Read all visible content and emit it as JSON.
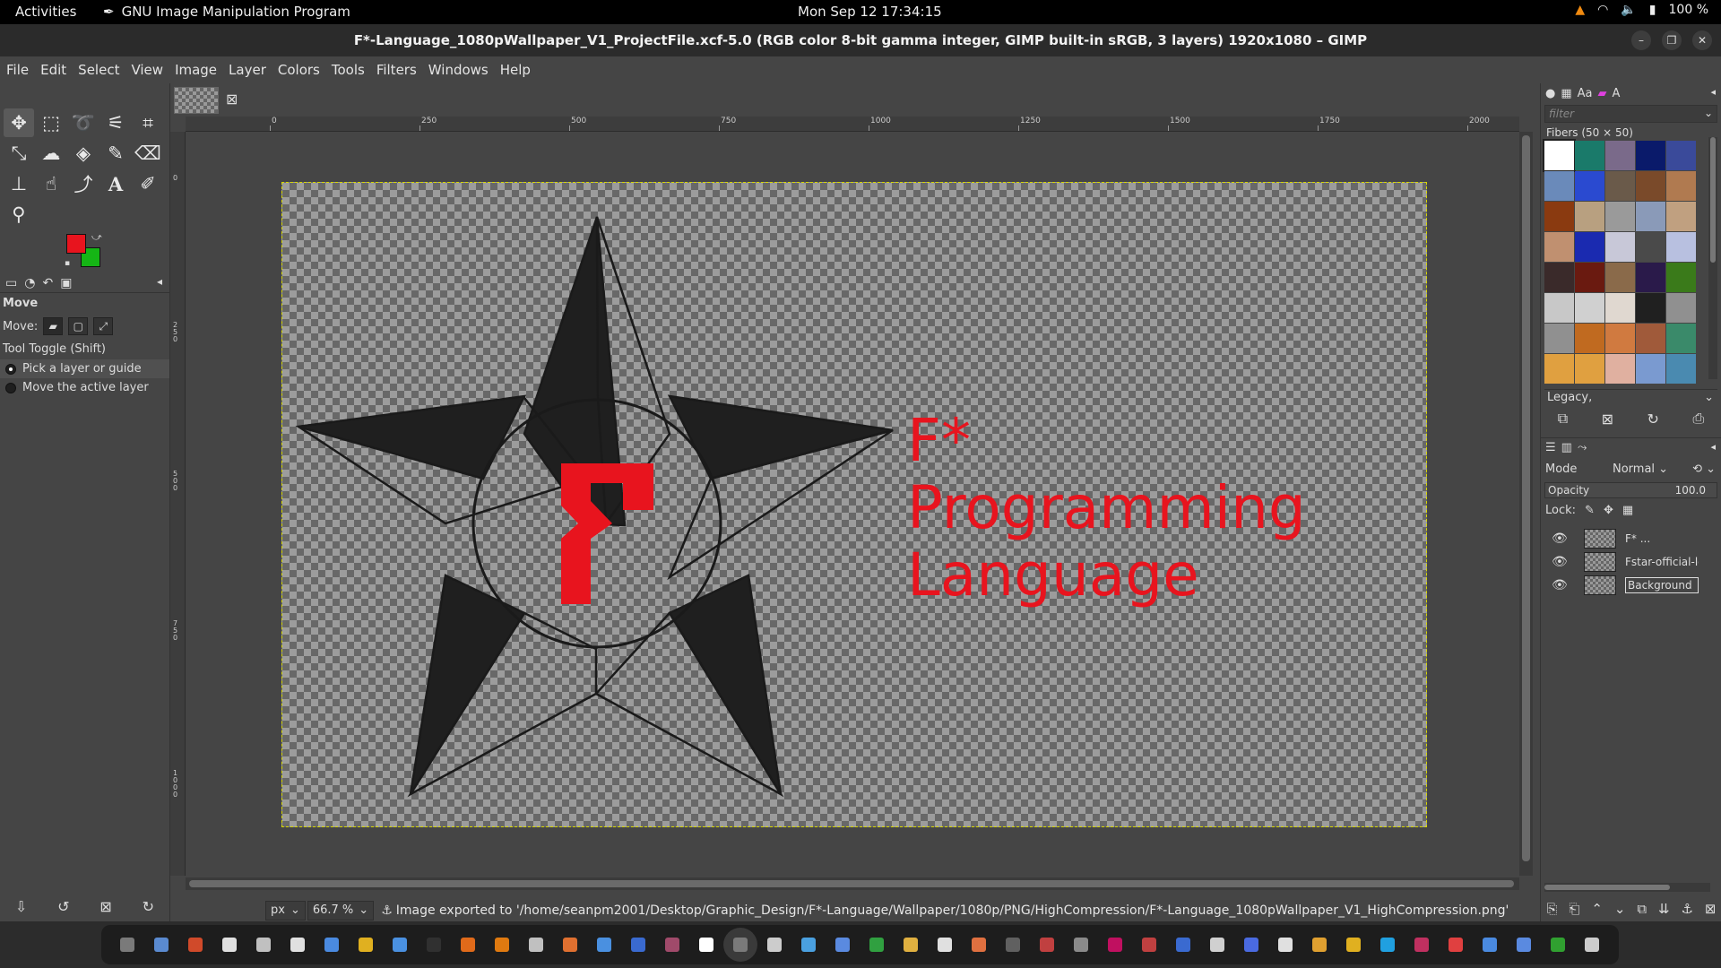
{
  "topbar": {
    "activities": "Activities",
    "app_name": "GNU Image Manipulation Program",
    "clock": "Mon Sep 12  17:34:15",
    "battery": "100 %"
  },
  "window": {
    "title": "F*-Language_1080pWallpaper_V1_ProjectFile.xcf-5.0 (RGB color 8-bit gamma integer, GIMP built-in sRGB, 3 layers) 1920x1080 – GIMP"
  },
  "menu": [
    "File",
    "Edit",
    "Select",
    "View",
    "Image",
    "Layer",
    "Colors",
    "Tools",
    "Filters",
    "Windows",
    "Help"
  ],
  "toolbox": {
    "tools": [
      "move-tool-icon",
      "rect-select-icon",
      "lasso-icon",
      "fuzzy-select-icon",
      "crop-icon",
      "unified-transform-icon",
      "warp-icon",
      "bucket-fill-icon",
      "paintbrush-icon",
      "eraser-icon",
      "clone-icon",
      "smudge-icon",
      "paths-icon",
      "text-tool-icon",
      "color-picker-icon",
      "zoom-tool-icon"
    ],
    "fg_color": "#e8141e",
    "bg_color": "#15b515"
  },
  "tool_options": {
    "title": "Move",
    "move_label": "Move:",
    "toggle_label": "Tool Toggle  (Shift)",
    "option1": "Pick a layer or guide",
    "option2": "Move the active layer"
  },
  "ruler": {
    "h_labels": [
      "0",
      "250",
      "500",
      "750",
      "1000",
      "1250",
      "1500",
      "1750",
      "2000"
    ],
    "v_labels": [
      "0",
      "250",
      "500",
      "750",
      "1000"
    ]
  },
  "canvas": {
    "line1": "F*",
    "line2": "Programming",
    "line3": "Language",
    "text_color": "#e8141e",
    "star_color": "#1f1f1f"
  },
  "statusbar": {
    "unit": "px",
    "zoom": "66.7 %",
    "message": "Image exported to '/home/seanpm2001/Desktop/Graphic_Design/F*-Language/Wallpaper/1080p/PNG/HighCompression/F*-Language_1080pWallpaper_V1_HighCompression.png'"
  },
  "patterns": {
    "filter_placeholder": "filter",
    "label": "Fibers (50 × 50)",
    "preset": "Legacy,",
    "colors": [
      "#ffffff",
      "#1a7a6a",
      "#7a6a8a",
      "#0a1a6a",
      "#3a4a9a",
      "#6a8aba",
      "#2a4ad0",
      "#6a5a4a",
      "#7a4a2a",
      "#b07a50",
      "#8a3a10",
      "#b8a080",
      "#9a9a9a",
      "#8a9ab8",
      "#c0a080",
      "#c09070",
      "#1a2ab0",
      "#c8c8d8",
      "#4a4a4a",
      "#b8c0e0",
      "#3a2a2a",
      "#6a1a10",
      "#8a6a4a",
      "#2a1a4a",
      "#3a7a1a",
      "#c8c8c8",
      "#d0d0d0",
      "#e0d8d0",
      "#202020",
      "#909090",
      "#909090",
      "#c06a20",
      "#d07a40",
      "#a05a3a",
      "#3a8a6a",
      "#e0a040",
      "#e0a040",
      "#e0b0a0",
      "#7a9ad0",
      "#4a8ab0"
    ]
  },
  "layers": {
    "mode_label": "Mode",
    "mode_value": "Normal",
    "opacity_label": "Opacity",
    "opacity_value": "100.0",
    "lock_label": "Lock:",
    "items": [
      {
        "name": "F* ..."
      },
      {
        "name": "Fstar-official-lo"
      },
      {
        "name": "Background"
      }
    ]
  },
  "dock_colors": [
    "#7a7a7a",
    "#5a8ad0",
    "#d04a2a",
    "#e0e0e0",
    "#c0c0c0",
    "#e0e0e0",
    "#4a8ae0",
    "#e0b020",
    "#4a90e0",
    "#303030",
    "#e06a1a",
    "#e07a10",
    "#c0c0c0",
    "#e07030",
    "#4a90e0",
    "#3a6ad0",
    "#a04a6a",
    "#ffffff",
    "#7a7a7a",
    "#cccccc",
    "#4aa0e0",
    "#5a8ae0",
    "#30a040",
    "#e0b040",
    "#e0e0e0",
    "#e07040",
    "#606060",
    "#c04040",
    "#8a8a8a",
    "#c01060",
    "#c04040",
    "#3a6ad0",
    "#d0d0d0",
    "#4a6ae0",
    "#e0e0e0",
    "#e0a030",
    "#e0b020",
    "#20a0e0",
    "#c03060",
    "#e04040",
    "#4a8ae0",
    "#5a8ae0",
    "#30a030",
    "#cccccc"
  ]
}
